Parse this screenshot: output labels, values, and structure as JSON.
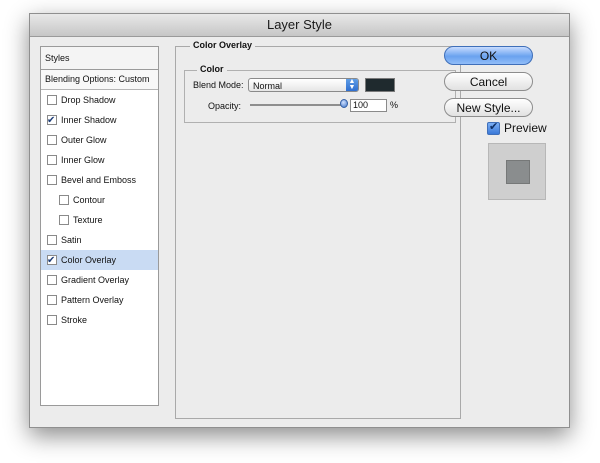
{
  "window": {
    "title": "Layer Style"
  },
  "styles": {
    "header": "Styles",
    "blending_options": "Blending Options: Custom",
    "items": [
      {
        "label": "Drop Shadow",
        "checked": false,
        "indent": false,
        "selected": false
      },
      {
        "label": "Inner Shadow",
        "checked": true,
        "indent": false,
        "selected": false
      },
      {
        "label": "Outer Glow",
        "checked": false,
        "indent": false,
        "selected": false
      },
      {
        "label": "Inner Glow",
        "checked": false,
        "indent": false,
        "selected": false
      },
      {
        "label": "Bevel and Emboss",
        "checked": false,
        "indent": false,
        "selected": false
      },
      {
        "label": "Contour",
        "checked": false,
        "indent": true,
        "selected": false
      },
      {
        "label": "Texture",
        "checked": false,
        "indent": true,
        "selected": false
      },
      {
        "label": "Satin",
        "checked": false,
        "indent": false,
        "selected": false
      },
      {
        "label": "Color Overlay",
        "checked": true,
        "indent": false,
        "selected": true
      },
      {
        "label": "Gradient Overlay",
        "checked": false,
        "indent": false,
        "selected": false
      },
      {
        "label": "Pattern Overlay",
        "checked": false,
        "indent": false,
        "selected": false
      },
      {
        "label": "Stroke",
        "checked": false,
        "indent": false,
        "selected": false
      }
    ]
  },
  "panel": {
    "title": "Color Overlay",
    "group_title": "Color",
    "blend_mode_label": "Blend Mode:",
    "blend_mode_value": "Normal",
    "color_swatch": "#1f2a2e",
    "opacity_label": "Opacity:",
    "opacity_value": "100",
    "opacity_unit": "%",
    "opacity_fraction": 1.0
  },
  "buttons": {
    "ok": "OK",
    "cancel": "Cancel",
    "new_style": "New Style...",
    "preview_label": "Preview",
    "preview_checked": true
  },
  "colors": {
    "selected_row": "#c9dbf3",
    "preview_inner": "#8a8d8e"
  }
}
